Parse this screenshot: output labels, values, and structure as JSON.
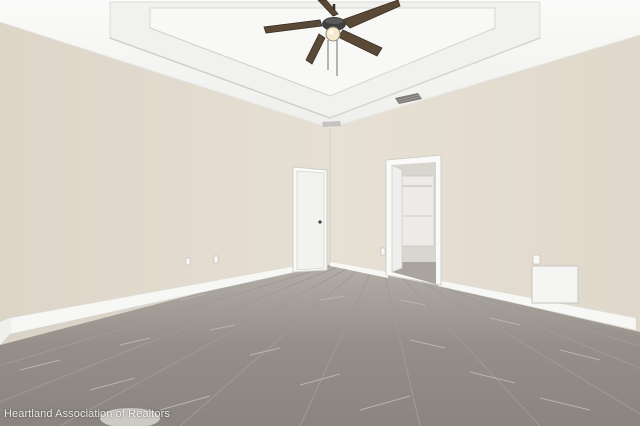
{
  "watermark": {
    "text": "Heartland Association of Realtors"
  },
  "scene": {
    "subject": "empty-bedroom",
    "colors": {
      "wall_left": "#e3dccf",
      "wall_back": "#e7e0d4",
      "wall_right": "#e4ddd0",
      "ceiling": "#f6f6f4",
      "baseboard": "#f7f7f5",
      "floor": "#8e8a84",
      "door": "#f4f4f2"
    },
    "icons": [
      "ceiling-fan-icon",
      "light-globe-icon",
      "air-vent-icon",
      "outlet-icon",
      "door-knob-icon"
    ]
  }
}
